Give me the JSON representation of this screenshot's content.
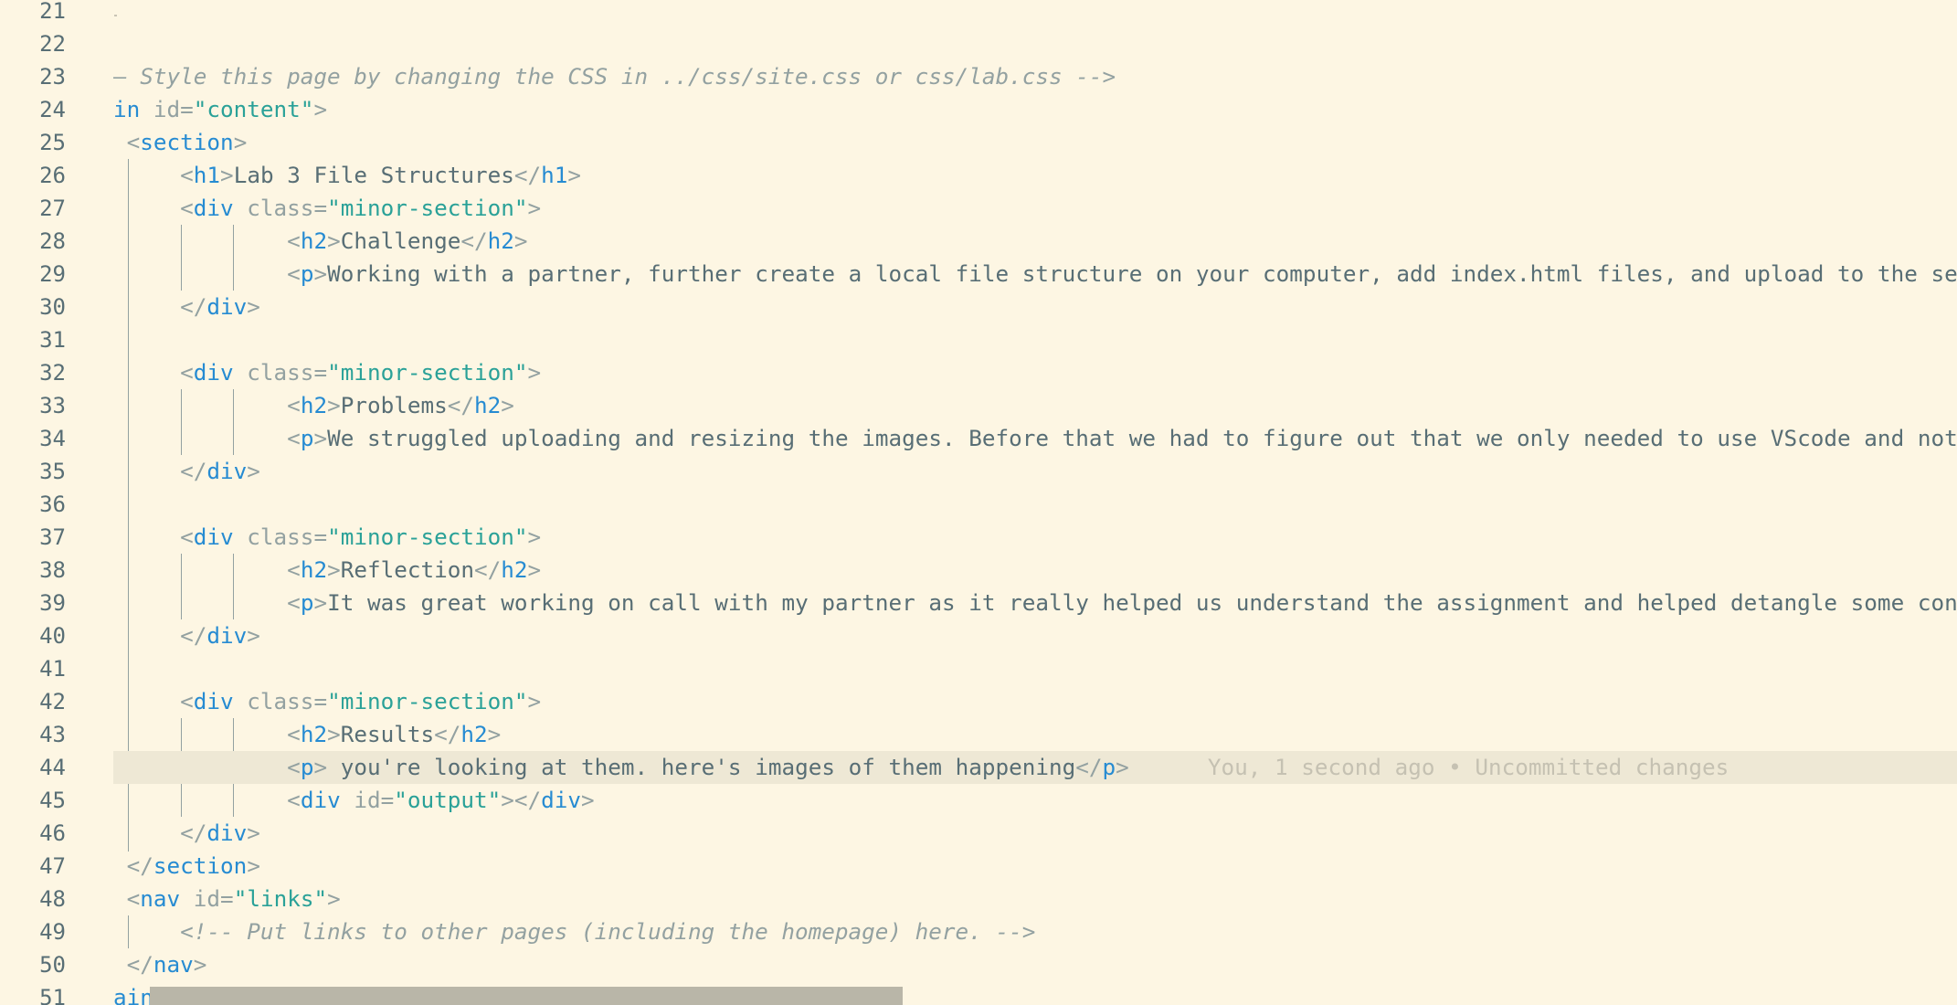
{
  "editor": {
    "line_numbers": [
      "21",
      "22",
      "23",
      "24",
      "25",
      "26",
      "27",
      "28",
      "29",
      "30",
      "31",
      "32",
      "33",
      "34",
      "35",
      "36",
      "37",
      "38",
      "39",
      "40",
      "41",
      "42",
      "43",
      "44",
      "45",
      "46",
      "47",
      "48",
      "49",
      "50",
      "51"
    ],
    "lines": {
      "l23": {
        "comment": "– Style this page by changing the CSS in ../css/site.css or css/lab.css -->"
      },
      "l24": {
        "kw": "in",
        "attr": " id=",
        "val": "\"content\"",
        "close": ">"
      },
      "l25": {
        "open": "<",
        "tag": "section",
        "close": ">"
      },
      "l26": {
        "open": "<",
        "tag": "h1",
        "mid": ">",
        "text": "Lab 3 File Structures",
        "endopen": "</",
        "endtag": "h1",
        "close": ">"
      },
      "l27": {
        "open": "<",
        "tag": "div",
        "attr": " class=",
        "val": "\"minor-section\"",
        "close": ">"
      },
      "l28": {
        "open": "<",
        "tag": "h2",
        "mid": ">",
        "text": "Challenge",
        "endopen": "</",
        "endtag": "h2",
        "close": ">"
      },
      "l29": {
        "open": "<",
        "tag": "p",
        "mid": ">",
        "text": "Working with a partner, further create a local file structure on your computer, add index.html files, and upload to the serv"
      },
      "l30": {
        "open": "</",
        "tag": "div",
        "close": ">"
      },
      "l32": {
        "open": "<",
        "tag": "div",
        "attr": " class=",
        "val": "\"minor-section\"",
        "close": ">"
      },
      "l33": {
        "open": "<",
        "tag": "h2",
        "mid": ">",
        "text": "Problems",
        "endopen": "</",
        "endtag": "h2",
        "close": ">"
      },
      "l34": {
        "open": "<",
        "tag": "p",
        "mid": ">",
        "text": "We struggled uploading and resizing the images. Before that we had to figure out that we only needed to use VScode and not t"
      },
      "l35": {
        "open": "</",
        "tag": "div",
        "close": ">"
      },
      "l37": {
        "open": "<",
        "tag": "div",
        "attr": " class=",
        "val": "\"minor-section\"",
        "close": ">"
      },
      "l38": {
        "open": "<",
        "tag": "h2",
        "mid": ">",
        "text": "Reflection",
        "endopen": "</",
        "endtag": "h2",
        "close": ">"
      },
      "l39": {
        "open": "<",
        "tag": "p",
        "mid": ">",
        "text": "It was great working on call with my partner as it really helped us understand the assignment and helped detangle some confu"
      },
      "l40": {
        "open": "</",
        "tag": "div",
        "close": ">"
      },
      "l42": {
        "open": "<",
        "tag": "div",
        "attr": " class=",
        "val": "\"minor-section\"",
        "close": ">"
      },
      "l43": {
        "open": "<",
        "tag": "h2",
        "mid": ">",
        "text": "Results",
        "endopen": "</",
        "endtag": "h2",
        "close": ">"
      },
      "l44": {
        "open": "<",
        "tag": "p",
        "mid": ">",
        "text": " you're looking at them. here's images of them happening",
        "endopen": "</",
        "endtag": "p",
        "close": ">",
        "blame": "You, 1 second ago • Uncommitted changes"
      },
      "l45": {
        "open": "<",
        "tag": "div",
        "attr": " id=",
        "val": "\"output\"",
        "mid": "></",
        "endtag": "div",
        "close": ">"
      },
      "l46": {
        "open": "</",
        "tag": "div",
        "close": ">"
      },
      "l47": {
        "open": "</",
        "tag": "section",
        "close": ">"
      },
      "l48": {
        "open": "<",
        "tag": "nav",
        "attr": " id=",
        "val": "\"links\"",
        "close": ">"
      },
      "l49": {
        "comment": "<!-- Put links to other pages (including the homepage) here. -->"
      },
      "l50": {
        "open": "</",
        "tag": "nav",
        "close": ">"
      },
      "l51": {
        "text": "ain>"
      }
    }
  },
  "colors": {
    "background": "#fdf6e3",
    "current_line": "#eee8d5",
    "keyword": "#268bd2",
    "string": "#2aa198",
    "text": "#586e75",
    "muted": "#93a1a1"
  }
}
